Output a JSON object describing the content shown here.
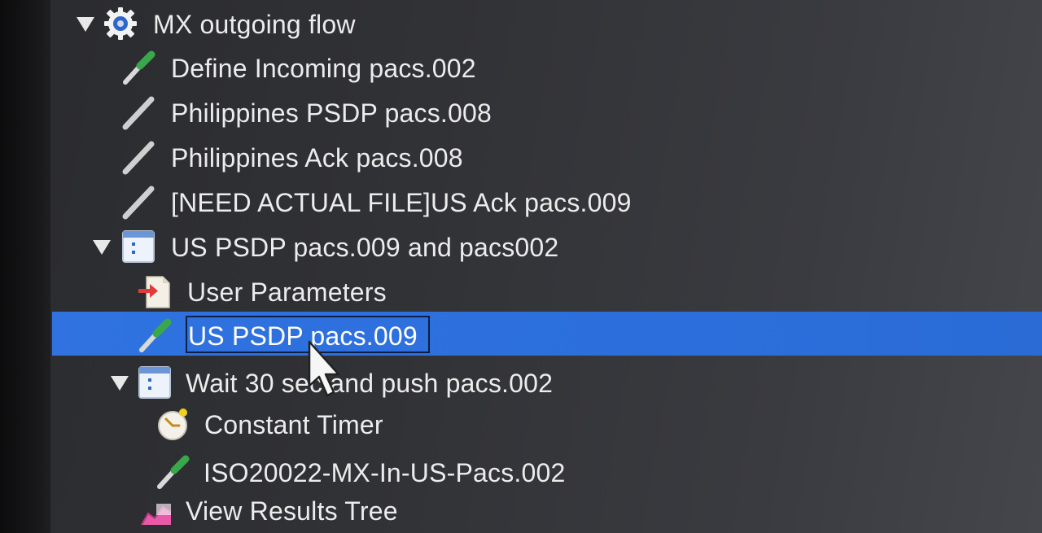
{
  "tree": {
    "items": [
      {
        "label": "MX outgoing flow",
        "icon": "gear-icon",
        "expanded": true
      },
      {
        "label": "Define Incoming pacs.002",
        "icon": "pipette-icon"
      },
      {
        "label": "Philippines PSDP pacs.008",
        "icon": "pipette-disabled-icon"
      },
      {
        "label": "Philippines Ack pacs.008",
        "icon": "pipette-disabled-icon"
      },
      {
        "label": "[NEED ACTUAL FILE]US Ack pacs.009",
        "icon": "pipette-disabled-icon"
      },
      {
        "label": "US PSDP pacs.009 and pacs002",
        "icon": "controller-icon",
        "expanded": true
      },
      {
        "label": "User Parameters",
        "icon": "user-parameters-icon"
      },
      {
        "label": "US PSDP pacs.009",
        "icon": "pipette-icon",
        "selected": true
      },
      {
        "label": "Wait 30 sec and push pacs.002",
        "icon": "controller-icon",
        "expanded": true
      },
      {
        "label": "Constant Timer",
        "icon": "timer-icon"
      },
      {
        "label": "ISO20022-MX-In-US-Pacs.002",
        "icon": "pipette-icon"
      },
      {
        "label": "View Results Tree",
        "icon": "chart-icon"
      }
    ]
  },
  "colors": {
    "selection": "#2f72e0",
    "text": "#ececec"
  }
}
